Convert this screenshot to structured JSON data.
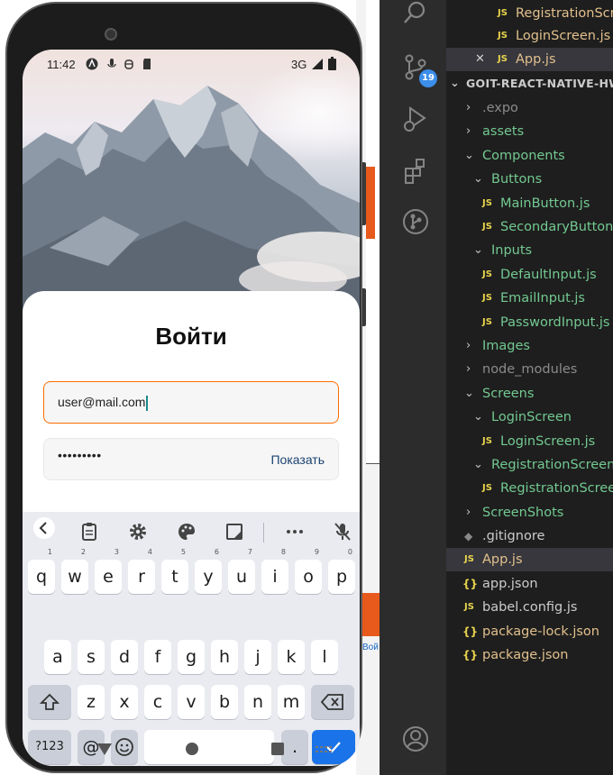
{
  "phone": {
    "status": {
      "time": "11:42",
      "network": "3G"
    },
    "login": {
      "title": "Войти",
      "email_value": "user@mail.com",
      "password_masked": "•••••••••",
      "show_label": "Показать"
    },
    "keyboard": {
      "row1": [
        "q",
        "w",
        "e",
        "r",
        "t",
        "y",
        "u",
        "i",
        "o",
        "p"
      ],
      "row1_hints": [
        "1",
        "2",
        "3",
        "4",
        "5",
        "6",
        "7",
        "8",
        "9",
        "0"
      ],
      "row2": [
        "a",
        "s",
        "d",
        "f",
        "g",
        "h",
        "j",
        "k",
        "l"
      ],
      "row3": [
        "z",
        "x",
        "c",
        "v",
        "b",
        "n",
        "m"
      ],
      "symbols_key": "?123",
      "at_key": "@",
      "period_key": "."
    }
  },
  "background": {
    "fragment": "Вой"
  },
  "vscode": {
    "scm_badge": "19",
    "open_editors": [
      {
        "label": "RegistrationScre",
        "icon": "js"
      },
      {
        "label": "LoginScreen.js",
        "icon": "js"
      },
      {
        "label": "App.js",
        "icon": "js"
      }
    ],
    "project": "GOIT-REACT-NATIVE-HW-",
    "tree": [
      {
        "label": ".expo",
        "type": "folder",
        "expanded": false
      },
      {
        "label": "assets",
        "type": "folder",
        "expanded": false
      },
      {
        "label": "Components",
        "type": "folder",
        "expanded": true
      },
      {
        "label": "Buttons",
        "type": "folder",
        "expanded": true
      },
      {
        "label": "MainButton.js",
        "type": "js"
      },
      {
        "label": "SecondaryButton.js",
        "type": "js"
      },
      {
        "label": "Inputs",
        "type": "folder",
        "expanded": true
      },
      {
        "label": "DefaultInput.js",
        "type": "js"
      },
      {
        "label": "EmailInput.js",
        "type": "js"
      },
      {
        "label": "PasswordInput.js",
        "type": "js"
      },
      {
        "label": "Images",
        "type": "folder",
        "expanded": false
      },
      {
        "label": "node_modules",
        "type": "folder",
        "expanded": false
      },
      {
        "label": "Screens",
        "type": "folder",
        "expanded": true
      },
      {
        "label": "LoginScreen",
        "type": "folder",
        "expanded": true
      },
      {
        "label": "LoginScreen.js",
        "type": "js"
      },
      {
        "label": "RegistrationScreen",
        "type": "folder",
        "expanded": true
      },
      {
        "label": "RegistrationScreen",
        "type": "js"
      },
      {
        "label": "ScreenShots",
        "type": "folder",
        "expanded": false
      },
      {
        "label": ".gitignore",
        "type": "git"
      },
      {
        "label": "App.js",
        "type": "js",
        "selected": true
      },
      {
        "label": "app.json",
        "type": "json"
      },
      {
        "label": "babel.config.js",
        "type": "js"
      },
      {
        "label": "package-lock.json",
        "type": "json"
      },
      {
        "label": "package.json",
        "type": "json"
      }
    ]
  }
}
